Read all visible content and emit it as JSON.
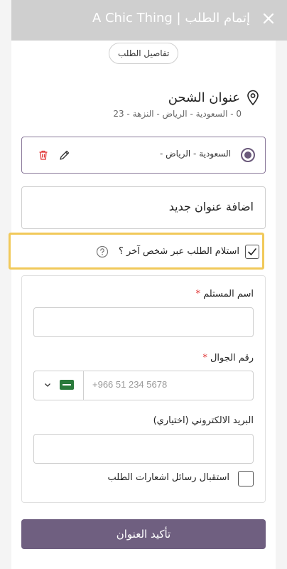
{
  "header": {
    "title": "إتمام الطلب | A Chic Thing"
  },
  "order_details_chip": "تفاصيل الطلب",
  "shipping": {
    "title": "عنوان الشحن",
    "summary": "0 - السعودية - الرياض - النزهة - 23"
  },
  "saved_address": {
    "label": "السعودية - الرياض -"
  },
  "add_address": {
    "label": "اضافة عنوان جديد"
  },
  "pickup_other": {
    "label": "استلام الطلب عبر شخص آخر ؟",
    "checked": true
  },
  "recipient": {
    "name_label": "اسم المستلم",
    "phone_label": "رقم الجوال",
    "phone_placeholder": "+966 51 234 5678",
    "email_label": "البريد الالكتروني (اختياري)",
    "notify_label": "استقبال رسائل اشعارات الطلب",
    "required_mark": "*"
  },
  "confirm_button": "تأكيد العنوان",
  "colors": {
    "accent": "#6f5f80",
    "highlight": "#f1c95a",
    "danger": "#e03535"
  }
}
